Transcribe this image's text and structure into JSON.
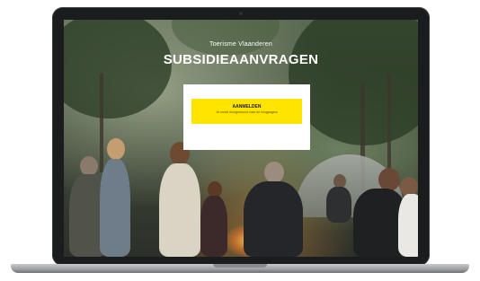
{
  "hero": {
    "subtitle": "Toerisme Vlaanderen",
    "title": "SUBSIDIEAANVRAGEN"
  },
  "card": {
    "cta_label": "AANMELDEN",
    "cta_sub": "Je wordt doorgestuurd naar de inlogpagina"
  },
  "colors": {
    "cta_bg": "#ffe400",
    "laptop_frame": "#1b1c1e",
    "card_bg": "#ffffff"
  }
}
